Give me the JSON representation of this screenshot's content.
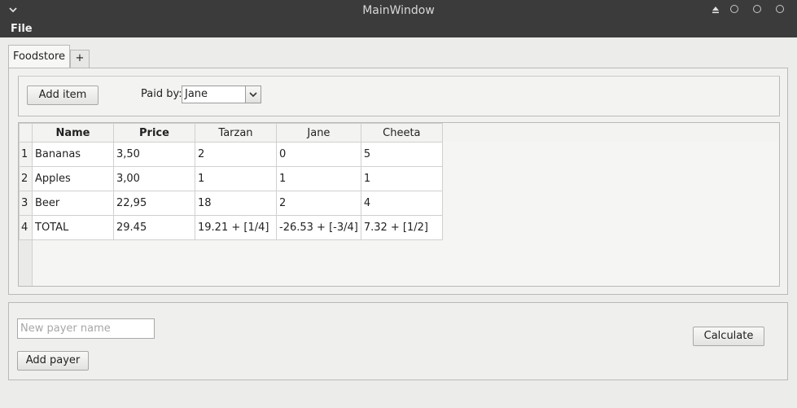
{
  "window": {
    "title": "MainWindow"
  },
  "menu": {
    "file_label": "File"
  },
  "tabs": [
    {
      "label": "Foodstore"
    },
    {
      "label": "+"
    }
  ],
  "toolbar": {
    "add_item_label": "Add item",
    "paid_by_label": "Paid by:",
    "paid_by_value": "Jane"
  },
  "table": {
    "headers": [
      "Name",
      "Price",
      "Tarzan",
      "Jane",
      "Cheeta"
    ],
    "rows": [
      {
        "num": "1",
        "cells": [
          "Bananas",
          "3,50",
          "2",
          "0",
          "5"
        ]
      },
      {
        "num": "2",
        "cells": [
          "Apples",
          "3,00",
          "1",
          "1",
          "1"
        ]
      },
      {
        "num": "3",
        "cells": [
          "Beer",
          "22,95",
          "18",
          "2",
          "4"
        ]
      },
      {
        "num": "4",
        "cells": [
          "TOTAL",
          "29.45",
          "19.21 + [1/4]",
          "-26.53 + [-3/4]",
          "7.32 + [1/2]"
        ]
      }
    ]
  },
  "payer": {
    "placeholder": "New payer name",
    "value": "",
    "add_label": "Add payer",
    "calculate_label": "Calculate"
  }
}
